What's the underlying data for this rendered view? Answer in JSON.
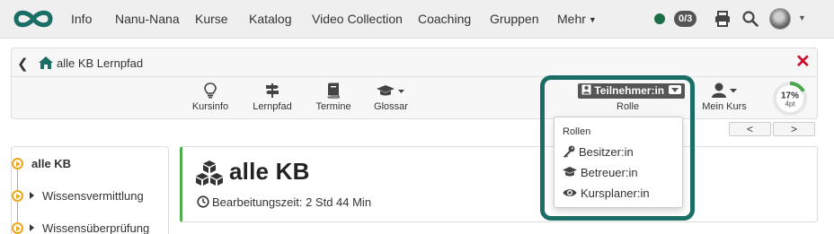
{
  "nav": {
    "items": [
      "Info",
      "Nanu-Nana",
      "Kurse",
      "Katalog",
      "Video Collection",
      "Coaching",
      "Gruppen",
      "Mehr"
    ],
    "count_badge": "0/3"
  },
  "course": {
    "breadcrumb": "alle KB Lernpfad",
    "tools": [
      "Kursinfo",
      "Lernpfad",
      "Termine",
      "Glossar"
    ],
    "role_button": "Teilnehmer:in",
    "role_label": "Rolle",
    "my_course": "Mein Kurs",
    "progress": {
      "percent_label": "17%",
      "points_label": "4pt",
      "fraction": 0.17
    }
  },
  "pager": {
    "prev": "<",
    "next": ">"
  },
  "sidebar": {
    "items": [
      {
        "label": "alle KB",
        "bold": true
      },
      {
        "label": "Wissensvermittlung",
        "bold": false
      },
      {
        "label": "Wissensüberprüfung",
        "bold": false
      }
    ]
  },
  "content": {
    "title": "alle KB",
    "meta": "Bearbeitungszeit: 2 Std 44 Min"
  },
  "roles_dropdown": {
    "header": "Rollen",
    "items": [
      "Besitzer:in",
      "Betreuer:in",
      "Kursplaner:in"
    ]
  },
  "colors": {
    "accent_teal": "#1a6e66",
    "status_green": "#1c6e46",
    "close_red": "#c8102e",
    "tree_orange": "#e7a81e",
    "content_border_green": "#4cae4c"
  },
  "icons": [
    "infinity-logo-icon",
    "print-icon",
    "search-icon",
    "lightbulb-icon",
    "signpost-icon",
    "book-icon",
    "graduation-cap-icon",
    "user-icon",
    "home-icon",
    "close-icon",
    "cubes-icon",
    "clock-icon",
    "key-icon",
    "eye-icon"
  ]
}
